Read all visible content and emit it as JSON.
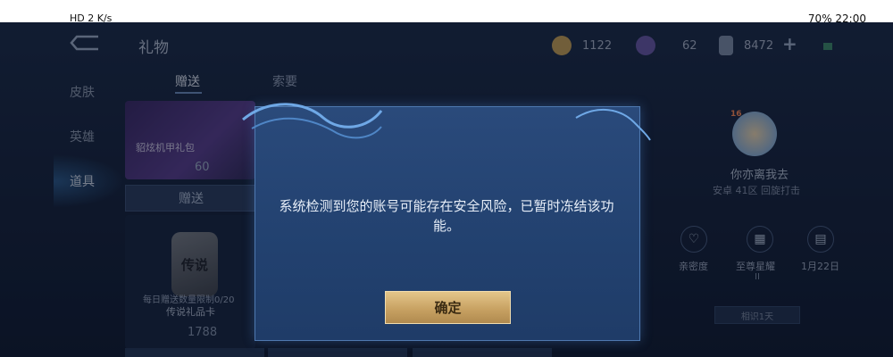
{
  "status_bar": {
    "left": "HD 2  K/s",
    "right": "70%  22:00"
  },
  "screen": {
    "title": "礼物"
  },
  "currencies": [
    {
      "icon": "coin-icon",
      "value": "1122",
      "color": "#c9a256"
    },
    {
      "icon": "gem-icon",
      "value": "62",
      "color": "#6a5aa8"
    },
    {
      "icon": "voucher-icon",
      "value": "8472",
      "color": "#7f8ea8"
    }
  ],
  "sidebar": {
    "items": [
      {
        "label": "皮肤"
      },
      {
        "label": "英雄"
      },
      {
        "label": "道具"
      }
    ]
  },
  "tabs": [
    {
      "label": "赠送"
    },
    {
      "label": "索要"
    }
  ],
  "gift_cards": {
    "first": {
      "name": "貂炫机甲礼包",
      "price": "60",
      "gift_label": "赠送"
    },
    "second": {
      "icon_text": "传说",
      "daily_text": "每日赠送数量限制0/20",
      "name": "传说礼品卡",
      "price": "1788"
    }
  },
  "friend": {
    "level": "16",
    "name": "你亦离我去",
    "server": "安卓 41区 回旋打击",
    "stats": [
      {
        "icon": "heart-icon",
        "label": "亲密度"
      },
      {
        "icon": "gift-box-icon",
        "label": "至尊星耀"
      },
      {
        "icon": "cake-icon",
        "label": "1月22日"
      }
    ],
    "stat_sub": "II",
    "button_label": "相识1天"
  },
  "dialog": {
    "message": "系统检测到您的账号可能存在安全风险，已暂时冻结该功能。",
    "confirm_label": "确定"
  }
}
